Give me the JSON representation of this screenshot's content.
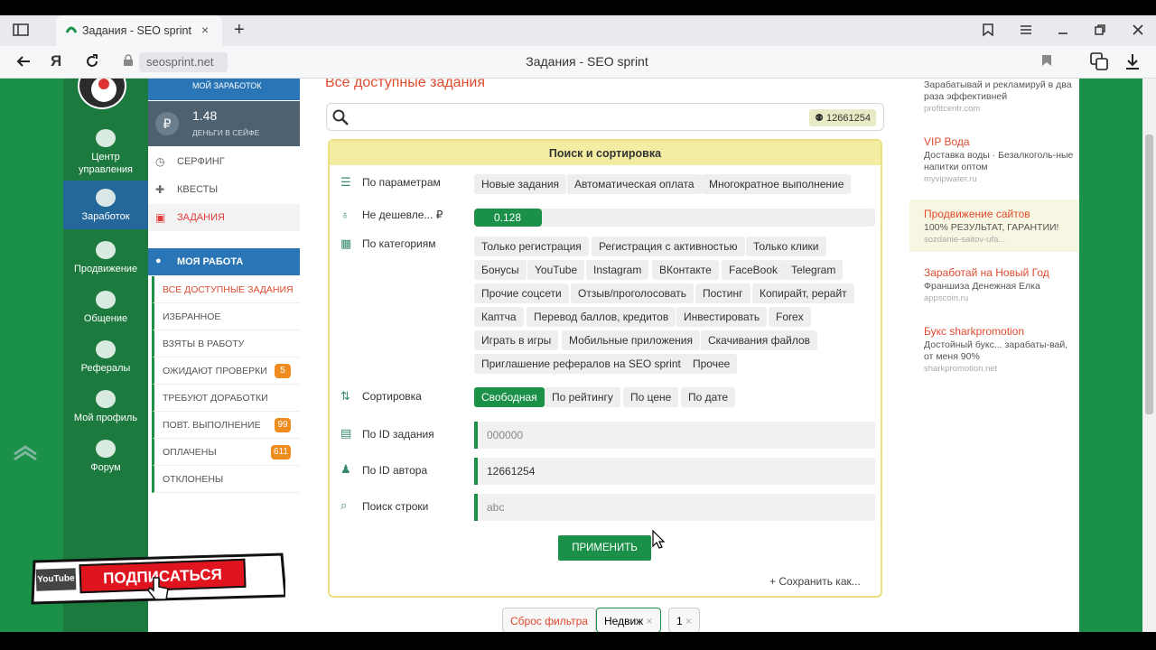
{
  "browser": {
    "tab_title": "Задания - SEO sprint",
    "url": "seosprint.net",
    "window_title": "Задания - SEO sprint",
    "new_tab": "+",
    "close_tab": "×"
  },
  "left_nav": [
    {
      "label": "Центр управления",
      "icon": "control-center-icon"
    },
    {
      "label": "Заработок",
      "icon": "money-bag-icon",
      "active": true
    },
    {
      "label": "Продвижение",
      "icon": "promotion-icon"
    },
    {
      "label": "Общение",
      "icon": "chat-icon"
    },
    {
      "label": "Рефералы",
      "icon": "referrals-icon"
    },
    {
      "label": "Мой профиль",
      "icon": "profile-icon"
    },
    {
      "label": "Форум",
      "icon": "forum-icon"
    }
  ],
  "wallet": {
    "earnings_label": "МОЙ ЗАРАБОТОК",
    "safe_value": "1.48",
    "safe_label": "ДЕНЬГИ В СЕЙФЕ",
    "currency": "₽"
  },
  "menu": {
    "items": [
      "СЕРФИНГ",
      "КВЕСТЫ",
      "ЗАДАНИЯ"
    ],
    "my_work": "МОЯ РАБОТА",
    "sub": [
      {
        "label": "ВСЕ ДОСТУПНЫЕ ЗАДАНИЯ",
        "badge": ""
      },
      {
        "label": "ИЗБРАННОЕ",
        "badge": ""
      },
      {
        "label": "ВЗЯТЫ В РАБОТУ",
        "badge": ""
      },
      {
        "label": "ОЖИДАЮТ ПРОВЕРКИ",
        "badge": "5"
      },
      {
        "label": "ТРЕБУЮТ ДОРАБОТКИ",
        "badge": ""
      },
      {
        "label": "ПОВТ. ВЫПОЛНЕНИЕ",
        "badge": "99"
      },
      {
        "label": "ОПЛАЧЕНЫ",
        "badge": "611"
      },
      {
        "label": "ОТКЛОНЕНЫ",
        "badge": ""
      }
    ]
  },
  "main": {
    "title": "Все доступные задания",
    "user_id": "12661254",
    "panel_title": "Поиск и сортировка",
    "params_label": "По параметрам",
    "params": [
      "Новые задания",
      "Автоматическая оплата",
      "Многократное выполнение"
    ],
    "price_label": "Не дешевле... ₽",
    "price_value": "0.128",
    "categories_label": "По категориям",
    "categories": [
      [
        "Только регистрация",
        "Регистрация с активностью",
        "Только клики"
      ],
      [
        "Бонусы",
        "YouTube",
        "Instagram",
        "ВКонтакте",
        "FaceBook",
        "Telegram"
      ],
      [
        "Прочие соцсети",
        "Отзыв/проголосовать",
        "Постинг",
        "Копирайт, рерайт"
      ],
      [
        "Каптча",
        "Перевод баллов, кредитов",
        "Инвестировать",
        "Forex"
      ],
      [
        "Играть в игры",
        "Мобильные приложения",
        "Скачивания файлов"
      ],
      [
        "Приглашение рефералов на SEO sprint",
        "Прочее"
      ]
    ],
    "sort_label": "Сортировка",
    "sort": [
      "Свободная",
      "По рейтингу",
      "По цене",
      "По дате"
    ],
    "task_id_label": "По ID задания",
    "task_id_placeholder": "000000",
    "author_id_label": "По ID автора",
    "author_id_value": "12661254",
    "string_label": "Поиск строки",
    "string_placeholder": "abc",
    "apply": "ПРИМЕНИТЬ",
    "save_as": "+ Сохранить как...",
    "filters": [
      "Сброс фильтра",
      "Недвиж",
      "1"
    ]
  },
  "ads": [
    {
      "title": "",
      "text": "Зарабатывай и рекламируй в два раза эффективней",
      "url": "profitcentr.com"
    },
    {
      "title": "VIP Вода",
      "text": "Доставка воды · Безалкоголь-ные напитки оптом",
      "url": "myvipwater.ru"
    },
    {
      "title": "Продвижение сайтов",
      "text": "100% РЕЗУЛЬТАТ, ГАРАНТИИ!",
      "url": "sozdanie-saitov-ufa..."
    },
    {
      "title": "Заработай на Новый Год",
      "text": "Франшиза Денежная Елка",
      "url": "appscoin.ru"
    },
    {
      "title": "Букс sharkpromotion",
      "text": "Достойный букс... зарабаты-вай, от меня 90%",
      "url": "sharkpromotion.net"
    }
  ],
  "overlay": {
    "youtube": "YouTube",
    "subscribe": "ПОДПИСАТЬСЯ"
  },
  "colors": {
    "green": "#1b9049",
    "blue": "#2975b5",
    "accent_red": "#e04b2f",
    "badge_orange": "#ef8b1f"
  }
}
